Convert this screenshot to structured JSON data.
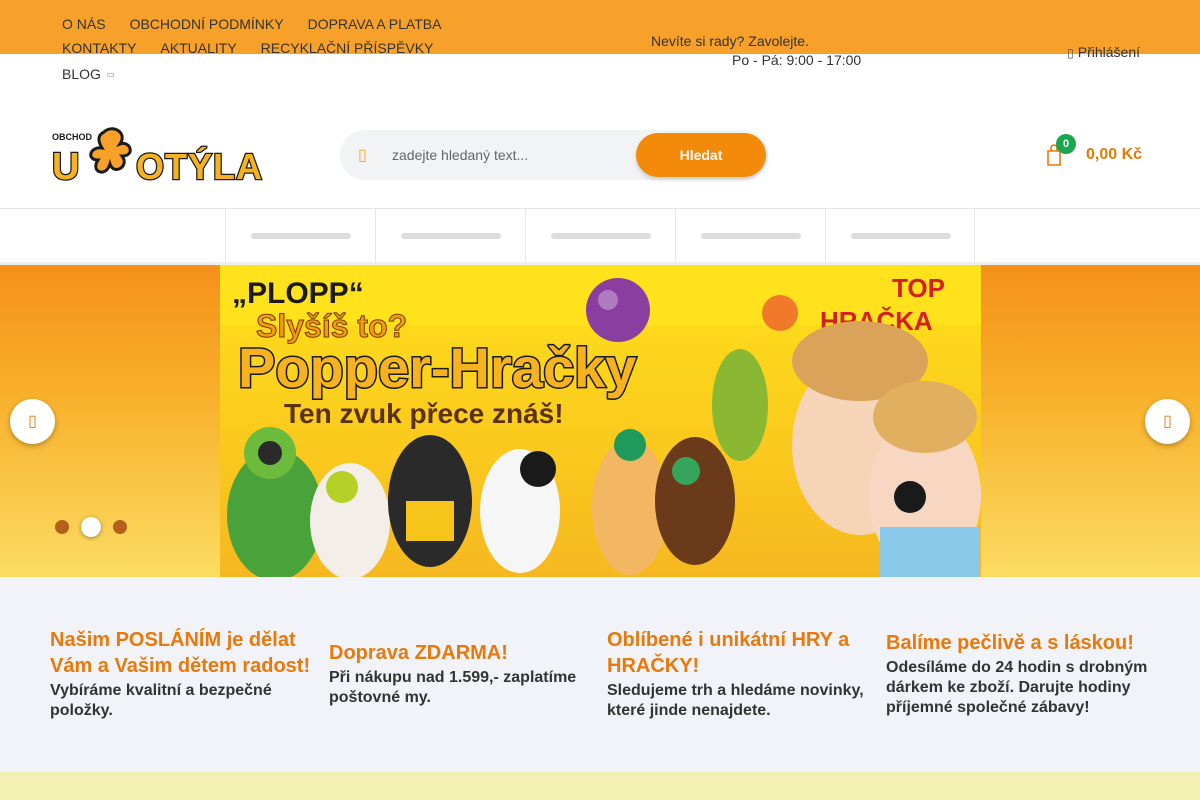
{
  "topnav": {
    "items": [
      "O nás",
      "Obchodní podmínky",
      "Doprava a platba",
      "Kontakty",
      "Aktuality",
      "Recyklační příspěvky"
    ],
    "blog": "Blog"
  },
  "contact": {
    "line1": "Nevíte si rady? Zavolejte.",
    "line2": "Po - Pá: 9:00 - 17:00"
  },
  "account": {
    "login": "Přihlášení",
    "icon": "user-icon"
  },
  "logo": {
    "small": "OBCHOD",
    "main": "U MOTÝLA"
  },
  "search": {
    "placeholder": "zadejte hledaný text...",
    "button": "Hledat",
    "icon": "search-icon"
  },
  "cart": {
    "count": "0",
    "total": "0,00 Kč",
    "icon": "shopping-bag-icon"
  },
  "banner": {
    "headline_small": "„PLOPP“",
    "headline_q": "Slyšíš to?",
    "title": "Popper-Hračky",
    "subtitle": "Ten zvuk přece znáš!",
    "badge_1": "TOP",
    "badge_2": "HRAČKA",
    "slides": 3,
    "active_slide": 2
  },
  "benefits": [
    {
      "title": "Našim POSLÁNÍM je dělat Vám a Vašim dětem radost!",
      "text": "Vybíráme kvalitní a bezpečné položky."
    },
    {
      "title": "Doprava ZDARMA!",
      "text": "Při nákupu nad 1.599,- zaplatíme poštovné my."
    },
    {
      "title": "Oblíbené i unikátní HRY a HRAČKY!",
      "text": "Sledujeme trh a hledáme novinky, které jinde nenajdete."
    },
    {
      "title": "Balíme pečlivě a s láskou!",
      "text": "Odesíláme do 24 hodin s drobným dárkem ke zboží. Darujte hodiny příjemné společné zábavy!"
    }
  ],
  "colors": {
    "accent": "#f7a12a",
    "button": "#f48a0a",
    "title_orange": "#e8790a",
    "badge_green": "#1aa84f"
  }
}
